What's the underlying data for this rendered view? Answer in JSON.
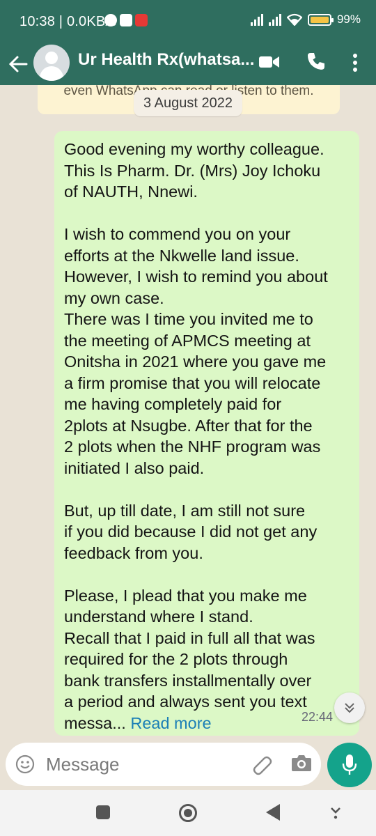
{
  "status_bar": {
    "time_speed": "10:38 | 0.0KB/s",
    "battery": "99%",
    "battery_level": 0.99
  },
  "header": {
    "title": "Ur Health Rx(whatsa...",
    "icons": [
      "back-arrow-icon",
      "avatar",
      "video-call-icon",
      "voice-call-icon",
      "more-options-icon"
    ]
  },
  "chat": {
    "previous_notice": "even WhatsApp can read or listen to them.",
    "date_label": "3 August 2022",
    "message": {
      "paragraph1": "Good evening my worthy colleague.\nThis Is Pharm. Dr. (Mrs) Joy Ichoku\nof NAUTH, Nnewi.",
      "paragraph2": "I wish to commend you on your\nefforts at the Nkwelle land issue.\nHowever, I wish to remind you about\nmy own case.\nThere was I time you invited me to\nthe meeting of APMCS meeting at\nOnitsha in 2021 where you gave me\na firm promise that you will relocate\nme having completely paid for\n2plots at Nsugbe. After that for the\n2 plots when the NHF program was\ninitiated I also paid.",
      "paragraph3": "But, up till date, I am still not sure\nif you did because I did not get any\nfeedback from you.",
      "paragraph4": "Please, I plead that you make me\nunderstand where I stand.\nRecall that I paid in full all that was\nrequired for the 2 plots through\nbank transfers installmentally over\na period and always sent you text",
      "truncated_tail": "messa...",
      "read_more": "Read more",
      "time": "22:44"
    }
  },
  "composer": {
    "placeholder": "Message"
  },
  "colors": {
    "header": "#2f6e5f",
    "bubble": "#dcf8c6",
    "accent": "#14a38b",
    "link": "#1b7fb6"
  }
}
